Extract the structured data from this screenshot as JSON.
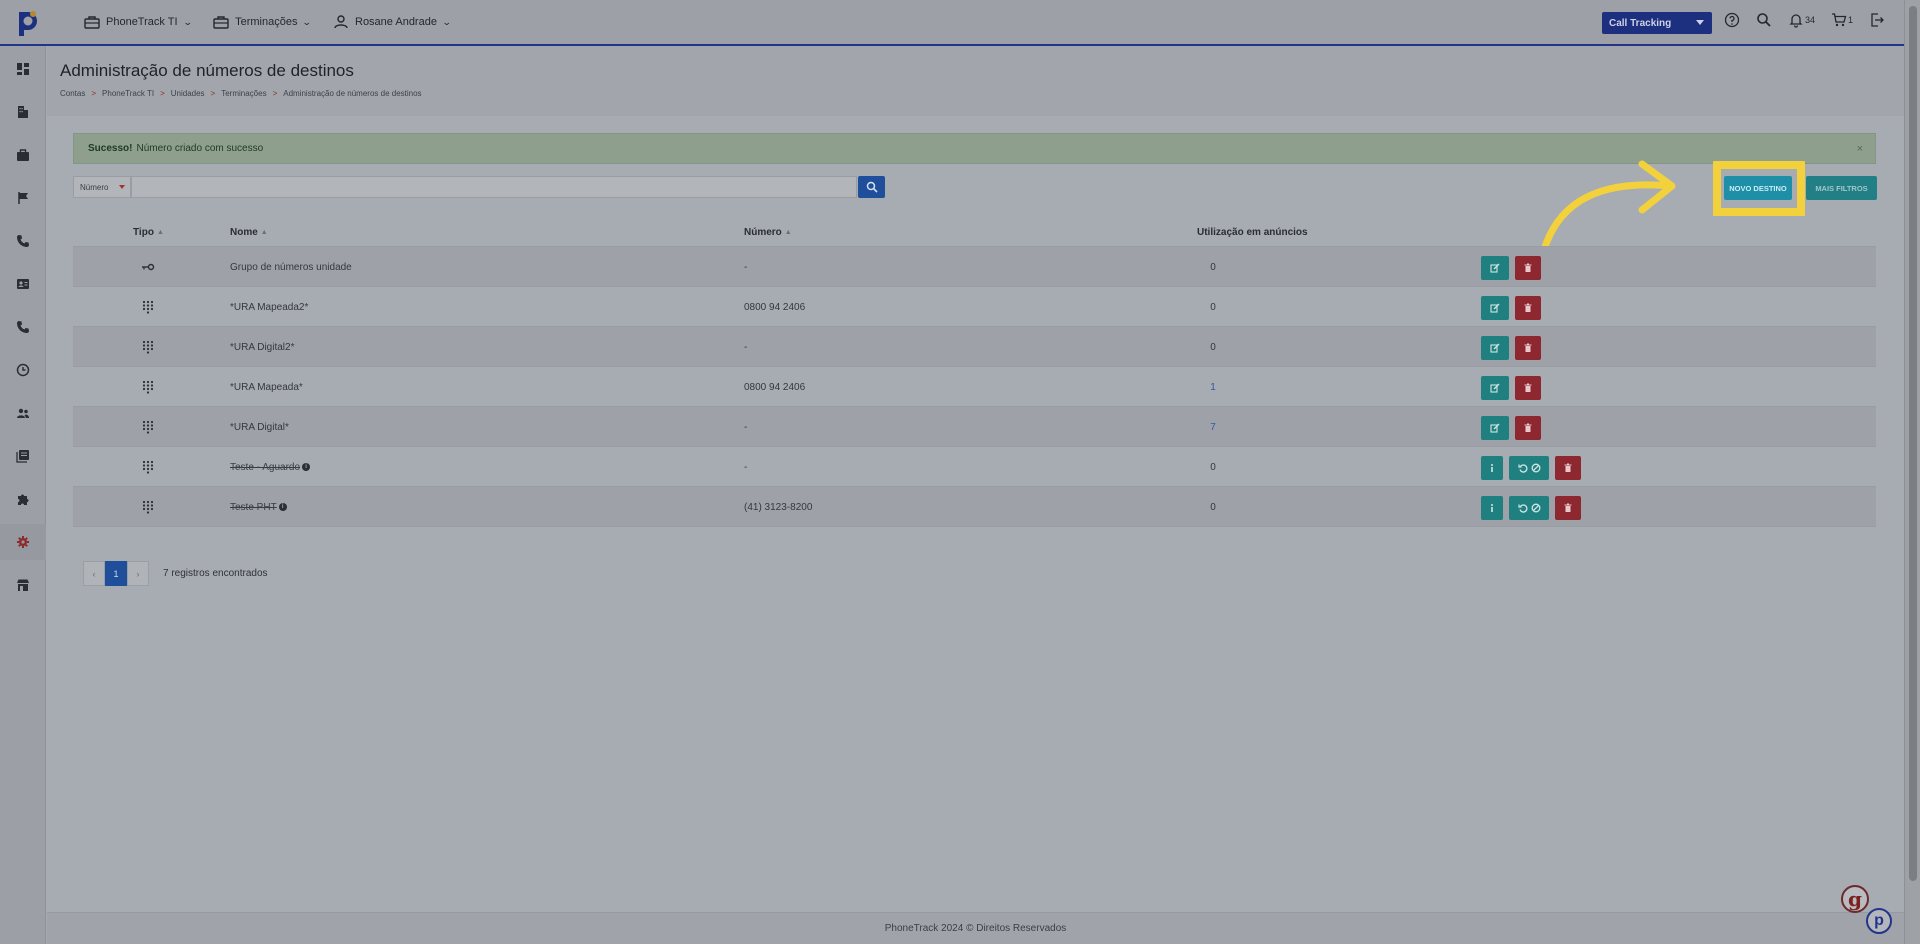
{
  "header": {
    "nav": [
      {
        "label": "PhoneTrack TI",
        "icon": "briefcase-icon"
      },
      {
        "label": "Terminações",
        "icon": "briefcase-icon"
      },
      {
        "label": "Rosane Andrade",
        "icon": "user-icon"
      }
    ],
    "product_select": "Call Tracking",
    "notifications_count": "34",
    "cart_count": "1"
  },
  "sidebar": {
    "items": [
      {
        "icon": "dashboard-icon"
      },
      {
        "icon": "building-icon"
      },
      {
        "icon": "briefcase-icon"
      },
      {
        "icon": "flag-icon"
      },
      {
        "icon": "phone-icon"
      },
      {
        "icon": "contact-card-icon"
      },
      {
        "icon": "phone-icon"
      },
      {
        "icon": "history-icon"
      },
      {
        "icon": "users-icon"
      },
      {
        "icon": "book-icon"
      },
      {
        "icon": "puzzle-icon"
      },
      {
        "icon": "gear-icon",
        "active": true
      },
      {
        "icon": "store-icon"
      }
    ]
  },
  "page": {
    "title": "Administração de números de destinos",
    "breadcrumb": [
      "Contas",
      "PhoneTrack TI",
      "Unidades",
      "Terminações",
      "Administração de números de destinos"
    ],
    "breadcrumb_sep": ">"
  },
  "alert": {
    "strong": "Sucesso!",
    "message": "Número criado com sucesso",
    "close": "×"
  },
  "filter": {
    "field": "Número",
    "placeholder": ""
  },
  "buttons": {
    "novo_destino": "NOVO DESTINO",
    "mais_filtros": "MAIS FILTROS"
  },
  "table": {
    "columns": {
      "tipo": "Tipo",
      "nome": "Nome",
      "numero": "Número",
      "utilizacao": "Utilização em anúncios"
    },
    "rows": [
      {
        "type_icon": "key-icon",
        "name": "Grupo de números unidade",
        "number": "-",
        "usage": "0",
        "disabled": false
      },
      {
        "type_icon": "dialpad-icon",
        "name": "*URA Mapeada2*",
        "number": "0800 94 2406",
        "usage": "0",
        "disabled": false
      },
      {
        "type_icon": "dialpad-icon",
        "name": "*URA Digital2*",
        "number": "-",
        "usage": "0",
        "disabled": false
      },
      {
        "type_icon": "dialpad-icon",
        "name": "*URA Mapeada*",
        "number": "0800 94 2406",
        "usage": "1",
        "disabled": false
      },
      {
        "type_icon": "dialpad-icon",
        "name": "*URA Digital*",
        "number": "-",
        "usage": "7",
        "disabled": false
      },
      {
        "type_icon": "dialpad-icon",
        "name": "Teste - Aguardo",
        "number": "-",
        "usage": "0",
        "disabled": true
      },
      {
        "type_icon": "dialpad-icon",
        "name": "Teste PHT",
        "number": "(41) 3123-8200",
        "usage": "0",
        "disabled": true
      }
    ]
  },
  "pagination": {
    "prev": "‹",
    "current": "1",
    "next": "›",
    "summary": "7 registros encontrados"
  },
  "footer": {
    "text": "PhoneTrack 2024 © Direitos Reservados"
  },
  "colors": {
    "brand_blue": "#23348b",
    "accent_teal": "#20807f",
    "danger": "#8d2730",
    "highlight": "#f2d13d"
  }
}
